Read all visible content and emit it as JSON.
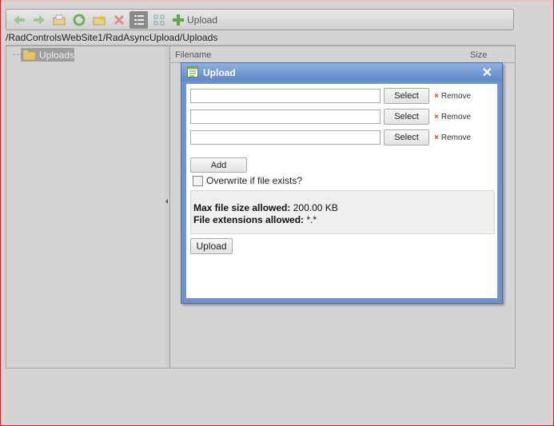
{
  "toolbar": {
    "buttons": [
      "back-arrow-icon",
      "forward-arrow-icon",
      "open-folder-icon",
      "refresh-icon",
      "new-folder-icon",
      "delete-icon",
      "details-view-icon",
      "thumbnail-view-icon"
    ],
    "upload_label": "Upload"
  },
  "address": {
    "path": "/RadControlsWebSite1/RadAsyncUpload/Uploads"
  },
  "tree": {
    "root_label": "Uploads"
  },
  "grid": {
    "col_filename": "Filename",
    "col_size": "Size"
  },
  "dialog": {
    "title": "Upload",
    "close_glyph": "✕",
    "rows": [
      {
        "select_label": "Select",
        "remove_label": "Remove",
        "remove_glyph": "×"
      },
      {
        "select_label": "Select",
        "remove_label": "Remove",
        "remove_glyph": "×"
      },
      {
        "select_label": "Select",
        "remove_label": "Remove",
        "remove_glyph": "×"
      }
    ],
    "add_label": "Add",
    "overwrite_label": "Overwrite if file exists?",
    "max_size_label": "Max file size allowed:",
    "max_size_value": "200.00 KB",
    "extensions_label": "File extensions allowed:",
    "extensions_value": "*.*",
    "upload_label": "Upload"
  },
  "colors": {
    "title_bar": "#6089c9",
    "remove_x": "#d9421a"
  }
}
